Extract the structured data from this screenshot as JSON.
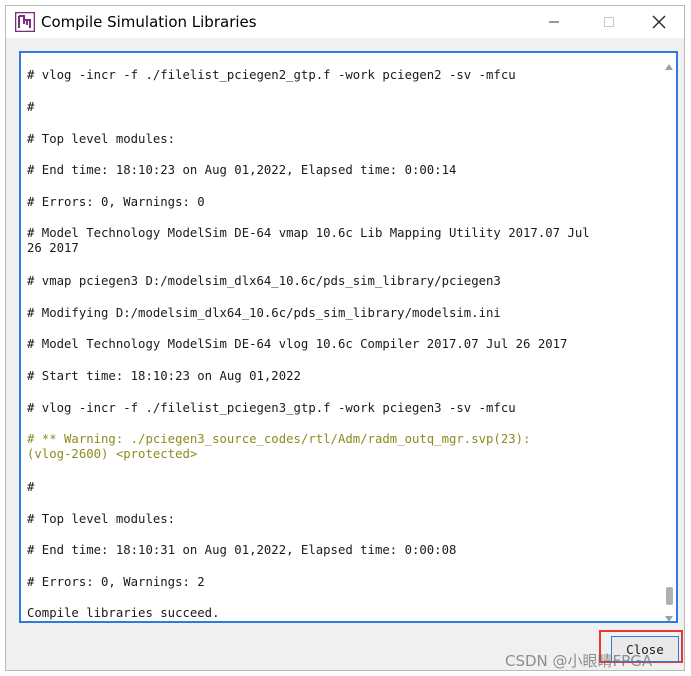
{
  "window": {
    "title": "Compile Simulation Libraries",
    "icon": "app-logo-icon",
    "controls": {
      "minimize": "minimize-icon",
      "maximize": "maximize-icon",
      "close": "close-icon"
    }
  },
  "log": {
    "lines": [
      {
        "text": "# vlog -incr -f ./filelist_pciegen2_gtp.f -work pciegen2 -sv -mfcu",
        "type": "normal"
      },
      {
        "text": "#",
        "type": "normal"
      },
      {
        "text": "# Top level modules:",
        "type": "normal"
      },
      {
        "text": "# End time: 18:10:23 on Aug 01,2022, Elapsed time: 0:00:14",
        "type": "normal"
      },
      {
        "text": "# Errors: 0, Warnings: 0",
        "type": "normal"
      },
      {
        "text": "# Model Technology ModelSim DE-64 vmap 10.6c Lib Mapping Utility 2017.07 Jul\n26 2017",
        "type": "normal"
      },
      {
        "text": "# vmap pciegen3 D:/modelsim_dlx64_10.6c/pds_sim_library/pciegen3",
        "type": "normal"
      },
      {
        "text": "# Modifying D:/modelsim_dlx64_10.6c/pds_sim_library/modelsim.ini",
        "type": "normal"
      },
      {
        "text": "# Model Technology ModelSim DE-64 vlog 10.6c Compiler 2017.07 Jul 26 2017",
        "type": "normal"
      },
      {
        "text": "# Start time: 18:10:23 on Aug 01,2022",
        "type": "normal"
      },
      {
        "text": "# vlog -incr -f ./filelist_pciegen3_gtp.f -work pciegen3 -sv -mfcu",
        "type": "normal"
      },
      {
        "text": "# ** Warning: ./pciegen3_source_codes/rtl/Adm/radm_outq_mgr.svp(23):\n(vlog-2600) <protected>",
        "type": "warning"
      },
      {
        "text": "#",
        "type": "normal"
      },
      {
        "text": "# Top level modules:",
        "type": "normal"
      },
      {
        "text": "# End time: 18:10:31 on Aug 01,2022, Elapsed time: 0:00:08",
        "type": "normal"
      },
      {
        "text": "# Errors: 0, Warnings: 2",
        "type": "normal"
      },
      {
        "text": "Compile libraries succeed.",
        "type": "normal"
      }
    ],
    "colors": {
      "normal": "#1a1a1a",
      "warning": "#8c8c1e",
      "border": "#2d7bdc"
    },
    "scroll_position": 0.97
  },
  "buttons": {
    "close_label": "Close"
  },
  "watermark": "CSDN @小眼睛FPGA"
}
